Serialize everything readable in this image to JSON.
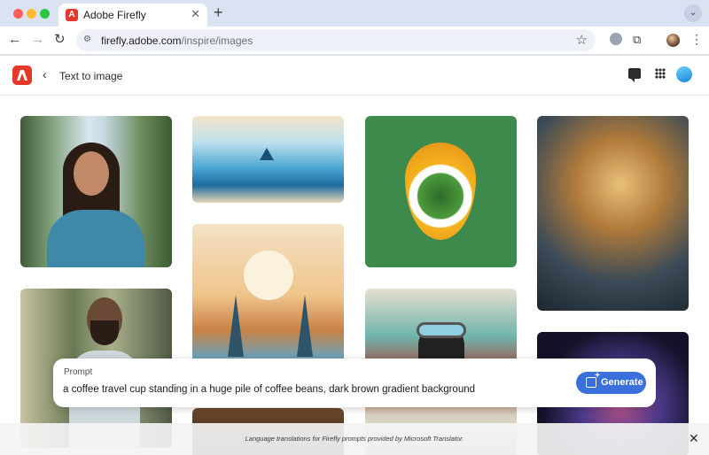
{
  "browser": {
    "tab_title": "Adobe Firefly",
    "tab_close": "✕",
    "new_tab": "+",
    "url_host": "firefly.adobe.com",
    "url_path": "/inspire/images"
  },
  "app": {
    "page_title": "Text to image",
    "brand_color": "#e3382a"
  },
  "prompt": {
    "label": "Prompt",
    "value": "a coffee travel cup standing in a huge pile of coffee beans, dark brown gradient background",
    "generate_label": "Generate",
    "accent": "#3a6fdc"
  },
  "notice": {
    "text": "Language translations for Firefly prompts provided by Microsoft Translator.",
    "close": "✕"
  }
}
